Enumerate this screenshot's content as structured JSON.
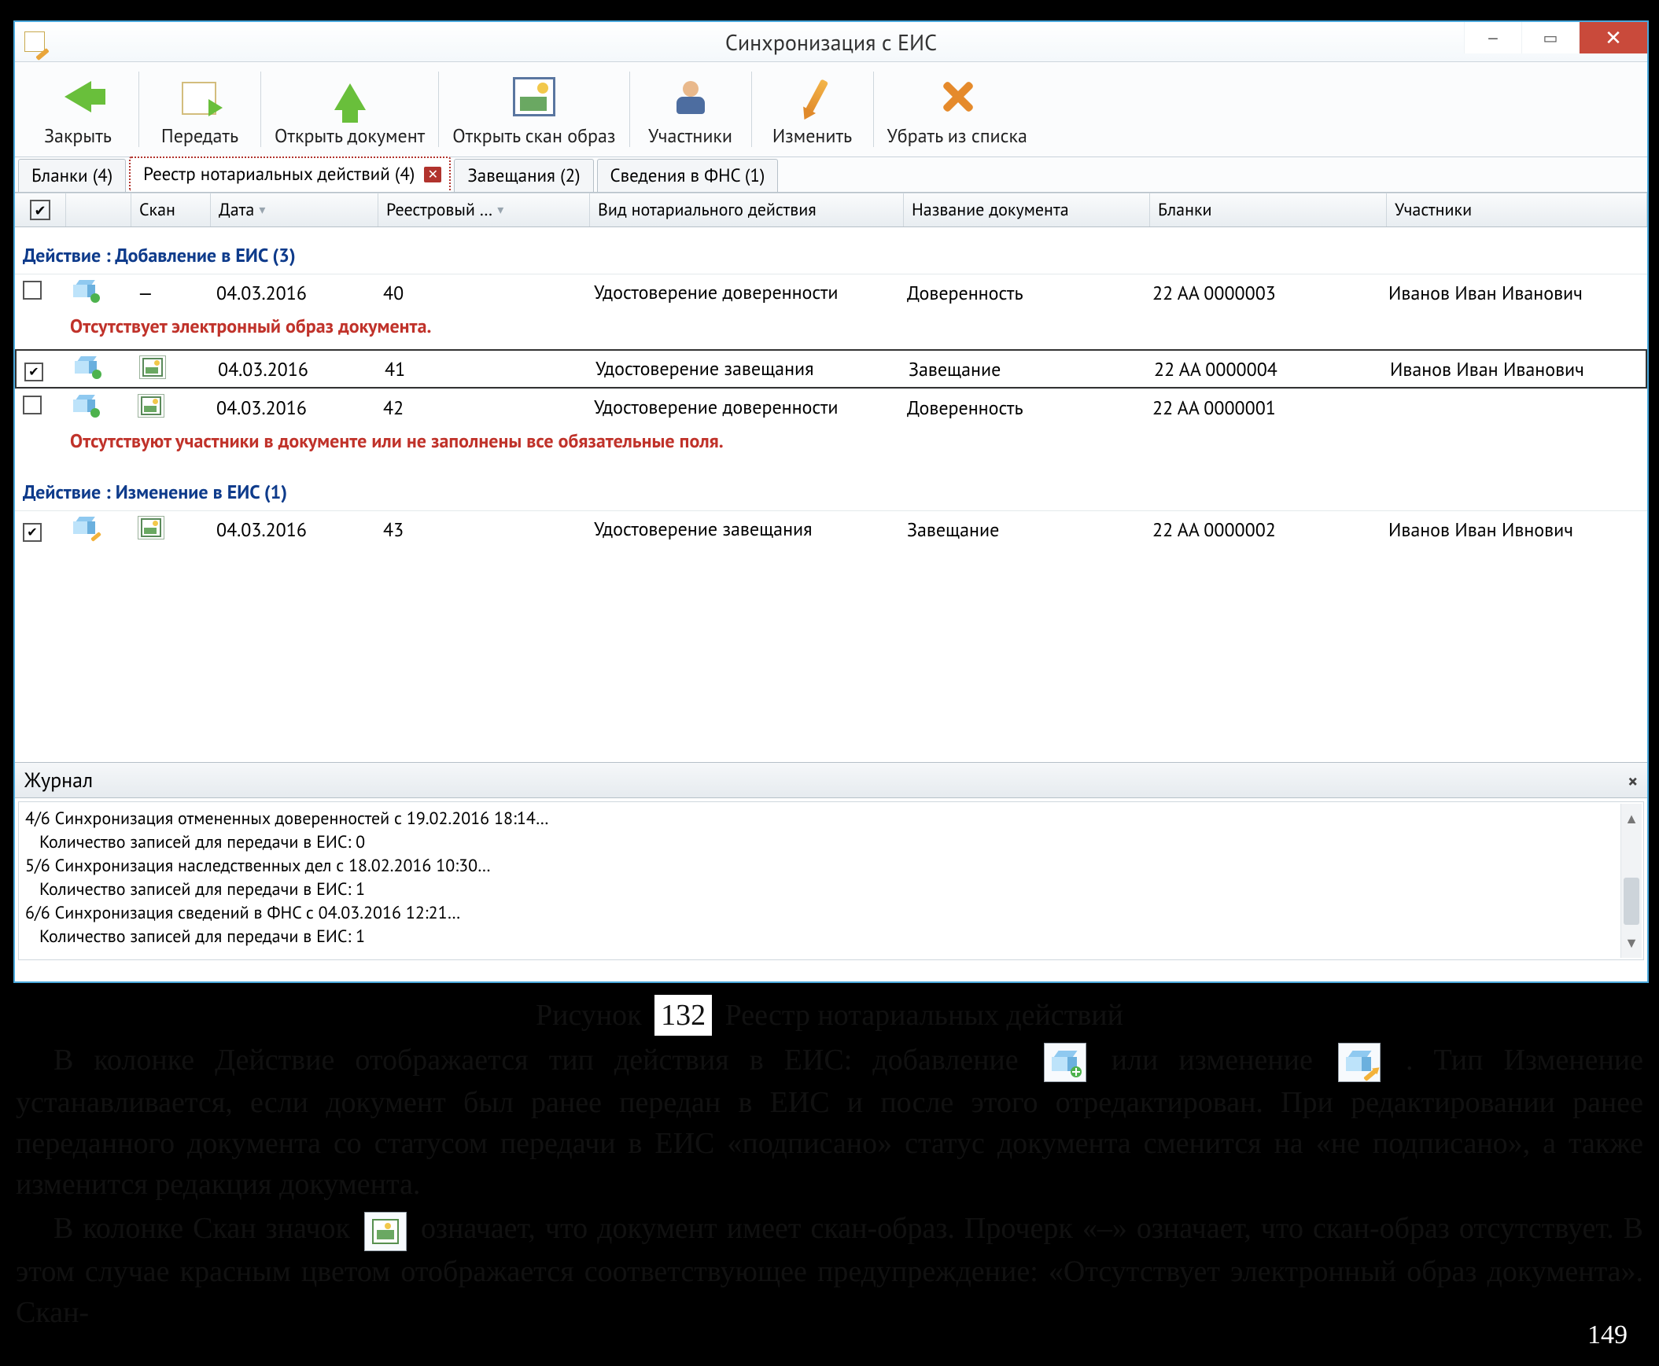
{
  "window": {
    "title": "Синхронизация с ЕИС",
    "controls": {
      "minimize": "—",
      "maximize": "▭",
      "close": "✕"
    }
  },
  "toolbar": {
    "close": "Закрыть",
    "transfer": "Передать",
    "open_doc": "Открыть документ",
    "open_scan": "Открыть скан образ",
    "participants": "Участники",
    "edit": "Изменить",
    "remove": "Убрать из списка"
  },
  "tabs": {
    "blanks": "Бланки (4)",
    "registry": "Реестр нотариальных действий (4)",
    "wills": "Завещания (2)",
    "fns": "Сведения в ФНС (1)"
  },
  "columns": {
    "scan": "Скан",
    "date": "Дата",
    "reg": "Реестровый …",
    "vid": "Вид нотариального действия",
    "name": "Название документа",
    "blanks": "Бланки",
    "participants": "Участники"
  },
  "groups": {
    "add": "Действие : Добавление в ЕИС (3)",
    "mod": "Действие : Изменение в ЕИС (1)"
  },
  "rows": {
    "add": [
      {
        "checked": false,
        "action": "add",
        "scan_icon": "none",
        "scan_text": "—",
        "date": "04.03.2016",
        "reg": "40",
        "vid": "Удостоверение доверенности",
        "name": "Доверенность",
        "blank": "22 АА 0000003",
        "part": "Иванов Иван Иванович",
        "warn": "Отсутствует электронный образ документа."
      },
      {
        "checked": true,
        "action": "add",
        "scan_icon": "scan",
        "date": "04.03.2016",
        "reg": "41",
        "vid": "Удостоверение завещания",
        "name": "Завещание",
        "blank": "22 АА 0000004",
        "part": "Иванов Иван Иванович",
        "selected": true
      },
      {
        "checked": false,
        "action": "add",
        "scan_icon": "scan",
        "date": "04.03.2016",
        "reg": "42",
        "vid": "Удостоверение доверенности",
        "name": "Доверенность",
        "blank": "22 АА 0000001",
        "part": "",
        "warn": "Отсутствуют участники в документе или не заполнены все обязательные поля."
      }
    ],
    "mod": [
      {
        "checked": true,
        "action": "mod",
        "scan_icon": "scan",
        "date": "04.03.2016",
        "reg": "43",
        "vid": "Удостоверение завещания",
        "name": "Завещание",
        "blank": "22 АА 0000002",
        "part": "Иванов Иван Ивнович"
      }
    ]
  },
  "log": {
    "title": "Журнал",
    "lines": [
      "4/6 Синхронизация отмененных доверенностей с 19.02.2016 18:14…",
      "  Количество записей для передачи в ЕИС: 0",
      "5/6 Синхронизация наследственных дел с 18.02.2016 10:30…",
      "  Количество записей для передачи в ЕИС: 1",
      "6/6 Синхронизация сведений в ФНС с 04.03.2016 12:21…",
      "  Количество записей для передачи в ЕИС: 1"
    ]
  },
  "doc": {
    "fig_caption_prefix": "Рисунок",
    "fig_num": "132",
    "fig_caption": "Реестр нотариальных действий",
    "p1a": "В колонке Действие отображается тип действия в ЕИС: добавление ",
    "p1b": " или изменение ",
    "p1c": ". Тип Изменение устанавливается, если документ был ранее передан в ЕИС и после этого отредактирован. При редактировании ранее переданного документа со статусом передачи в ЕИС «подписано» статус документа сменится на «не подписано», а также изменится редакция документа.",
    "p2a": "В колонке Скан значок ",
    "p2b": " означает, что документ имеет скан-образ. Прочерк «–» означает, что скан-образ отсутствует. В этом случае красным цветом отображается соответствующее предупреждение: «Отсутствует электронный образ документа». Скан-"
  },
  "page_number": "149"
}
